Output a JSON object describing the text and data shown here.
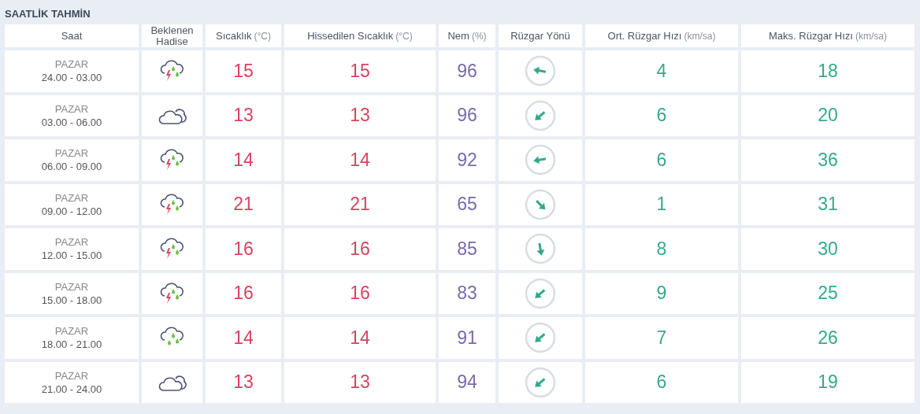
{
  "title": "SAATLİK TAHMİN",
  "columns": [
    {
      "label": "Saat"
    },
    {
      "label": "Beklenen Hadise"
    },
    {
      "label": "Sıcaklık",
      "unit": "(°C)"
    },
    {
      "label": "Hissedilen Sıcaklık",
      "unit": "(°C)"
    },
    {
      "label": "Nem",
      "unit": "(%)"
    },
    {
      "label": "Rüzgar Yönü"
    },
    {
      "label": "Ort. Rüzgar Hızı",
      "unit": "(km/sa)"
    },
    {
      "label": "Maks. Rüzgar Hızı",
      "unit": "(km/sa)"
    }
  ],
  "rows": [
    {
      "day": "PAZAR",
      "time": "24.00 - 03.00",
      "weather": {
        "kind": "thunder_rain"
      },
      "temp": "15",
      "feels": "15",
      "humidity": "96",
      "wind_arrow": {
        "kind": "west"
      },
      "wind_avg": "4",
      "wind_max": "18"
    },
    {
      "day": "PAZAR",
      "time": "03.00 - 06.00",
      "weather": {
        "kind": "cloudy"
      },
      "temp": "13",
      "feels": "13",
      "humidity": "96",
      "wind_arrow": {
        "kind": "southwest"
      },
      "wind_avg": "6",
      "wind_max": "20"
    },
    {
      "day": "PAZAR",
      "time": "06.00 - 09.00",
      "weather": {
        "kind": "thunder_rain"
      },
      "temp": "14",
      "feels": "14",
      "humidity": "92",
      "wind_arrow": {
        "kind": "westup"
      },
      "wind_avg": "6",
      "wind_max": "36"
    },
    {
      "day": "PAZAR",
      "time": "09.00 - 12.00",
      "weather": {
        "kind": "thunder_rain"
      },
      "temp": "21",
      "feels": "21",
      "humidity": "65",
      "wind_arrow": {
        "kind": "southeast"
      },
      "wind_avg": "1",
      "wind_max": "31"
    },
    {
      "day": "PAZAR",
      "time": "12.00 - 15.00",
      "weather": {
        "kind": "thunder_rain"
      },
      "temp": "16",
      "feels": "16",
      "humidity": "85",
      "wind_arrow": {
        "kind": "south"
      },
      "wind_avg": "8",
      "wind_max": "30"
    },
    {
      "day": "PAZAR",
      "time": "15.00 - 18.00",
      "weather": {
        "kind": "thunder_rain"
      },
      "temp": "16",
      "feels": "16",
      "humidity": "83",
      "wind_arrow": {
        "kind": "southwest"
      },
      "wind_avg": "9",
      "wind_max": "25"
    },
    {
      "day": "PAZAR",
      "time": "18.00 - 21.00",
      "weather": {
        "kind": "rain"
      },
      "temp": "14",
      "feels": "14",
      "humidity": "91",
      "wind_arrow": {
        "kind": "southwest"
      },
      "wind_avg": "7",
      "wind_max": "26"
    },
    {
      "day": "PAZAR",
      "time": "21.00 - 24.00",
      "weather": {
        "kind": "cloudy"
      },
      "temp": "13",
      "feels": "13",
      "humidity": "94",
      "wind_arrow": {
        "kind": "southwest"
      },
      "wind_avg": "6",
      "wind_max": "19"
    }
  ]
}
